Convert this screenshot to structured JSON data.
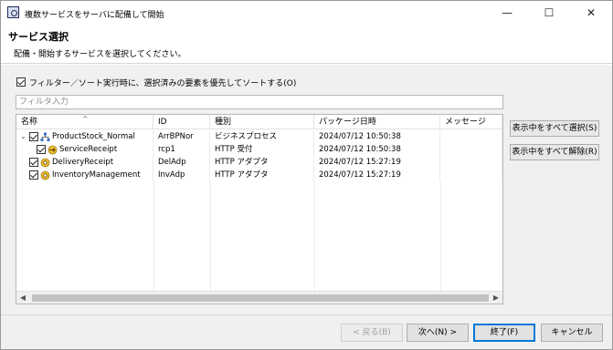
{
  "window": {
    "title": "複数サービスをサーバに配備して開始",
    "minimize_glyph": "—",
    "maximize_glyph": "☐",
    "close_glyph": "✕"
  },
  "header": {
    "title": "サービス選択",
    "description": "配備・開始するサービスを選択してください。"
  },
  "filter": {
    "checkbox_label": "フィルター／ソート実行時に、選択済みの要素を優先してソートする(O)",
    "checkbox_checked": true,
    "input_placeholder": "フィルタ入力",
    "input_value": ""
  },
  "table": {
    "sort_indicator": "^",
    "columns": [
      "名称",
      "ID",
      "種別",
      "パッケージ日時",
      "メッセージ"
    ],
    "rows": [
      {
        "name": "ProductStock_Normal",
        "id": "ArrBPNor",
        "type": "ビジネスプロセス",
        "date": "2024/07/12 10:50:38",
        "message": "",
        "expanded": true,
        "checked": true,
        "icon": "business-process-icon"
      },
      {
        "name": "ServiceReceipt",
        "id": "rcp1",
        "type": "HTTP 受付",
        "date": "2024/07/12 10:50:38",
        "message": "",
        "checked": true,
        "icon": "http-receiver-icon"
      },
      {
        "name": "DeliveryReceipt",
        "id": "DelAdp",
        "type": "HTTP アダプタ",
        "date": "2024/07/12 15:27:19",
        "message": "",
        "checked": true,
        "icon": "http-adapter-icon"
      },
      {
        "name": "InventoryManagement",
        "id": "InvAdp",
        "type": "HTTP アダプタ",
        "date": "2024/07/12 15:27:19",
        "message": "",
        "checked": true,
        "icon": "http-adapter-icon"
      }
    ]
  },
  "side_buttons": {
    "select_all": "表示中をすべて選択(S)",
    "deselect_all": "表示中をすべて解除(R)"
  },
  "footer": {
    "back": "< 戻る(B)",
    "next": "次へ(N) >",
    "finish": "終了(F)",
    "cancel": "キャンセル"
  },
  "colors": {
    "accent": "#0078d7",
    "dialog_bg": "#f0f0f0"
  }
}
